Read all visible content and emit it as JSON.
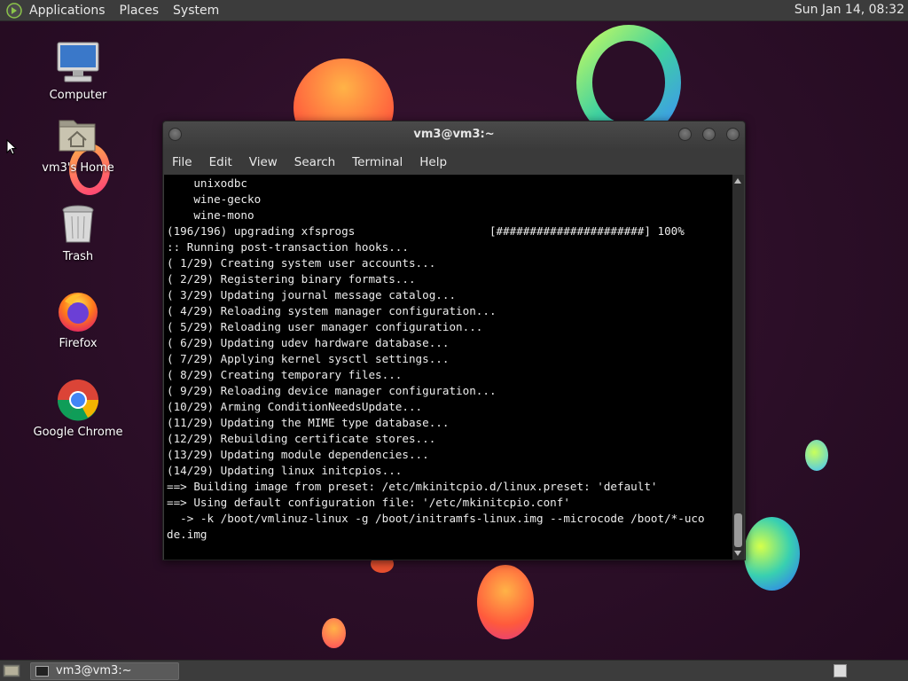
{
  "top_panel": {
    "menus": [
      "Applications",
      "Places",
      "System"
    ],
    "clock": "Sun Jan 14, 08:32"
  },
  "desktop_icons": [
    {
      "label": "Computer",
      "icon": "computer-icon"
    },
    {
      "label": "vm3's Home",
      "icon": "home-folder-icon"
    },
    {
      "label": "Trash",
      "icon": "trash-icon"
    },
    {
      "label": "Firefox",
      "icon": "firefox-icon"
    },
    {
      "label": "Google Chrome",
      "icon": "chrome-icon"
    }
  ],
  "terminal": {
    "title": "vm3@vm3:~",
    "menu": [
      "File",
      "Edit",
      "View",
      "Search",
      "Terminal",
      "Help"
    ],
    "lines": [
      "    unixodbc",
      "    wine-gecko",
      "    wine-mono",
      "(196/196) upgrading xfsprogs                    [######################] 100%",
      ":: Running post-transaction hooks...",
      "( 1/29) Creating system user accounts...",
      "( 2/29) Registering binary formats...",
      "( 3/29) Updating journal message catalog...",
      "( 4/29) Reloading system manager configuration...",
      "( 5/29) Reloading user manager configuration...",
      "( 6/29) Updating udev hardware database...",
      "( 7/29) Applying kernel sysctl settings...",
      "( 8/29) Creating temporary files...",
      "( 9/29) Reloading device manager configuration...",
      "(10/29) Arming ConditionNeedsUpdate...",
      "(11/29) Updating the MIME type database...",
      "(12/29) Rebuilding certificate stores...",
      "(13/29) Updating module dependencies...",
      "(14/29) Updating linux initcpios...",
      "==> Building image from preset: /etc/mkinitcpio.d/linux.preset: 'default'",
      "==> Using default configuration file: '/etc/mkinitcpio.conf'",
      "  -> -k /boot/vmlinuz-linux -g /boot/initramfs-linux.img --microcode /boot/*-uco",
      "de.img"
    ]
  },
  "taskbar": {
    "window_label": "vm3@vm3:~"
  },
  "colors": {
    "panel": "#3c3c3c",
    "terminal_bg": "#000000",
    "terminal_fg": "#ececec",
    "wallpaper": "#2b0e27"
  }
}
